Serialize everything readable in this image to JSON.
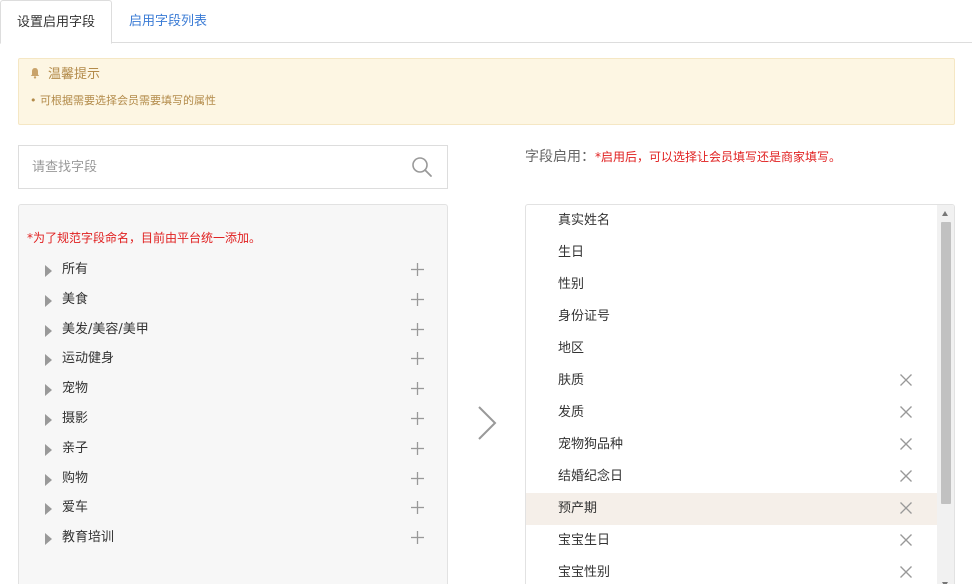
{
  "tabs": [
    {
      "label": "设置启用字段",
      "active": true
    },
    {
      "label": "启用字段列表",
      "active": false
    }
  ],
  "notice": {
    "icon": "bell-icon",
    "title": "温馨提示",
    "item": "• 可根据需要选择会员需要填写的属性"
  },
  "search": {
    "placeholder": "请查找字段",
    "value": "",
    "icon": "search-icon"
  },
  "left_panel": {
    "note": "*为了规范字段命名，目前由平台统一添加。",
    "categories": [
      {
        "label": "所有"
      },
      {
        "label": "美食"
      },
      {
        "label": "美发/美容/美甲"
      },
      {
        "label": "运动健身"
      },
      {
        "label": "宠物"
      },
      {
        "label": "摄影"
      },
      {
        "label": "亲子"
      },
      {
        "label": "购物"
      },
      {
        "label": "爱车"
      },
      {
        "label": "教育培训"
      }
    ]
  },
  "right_panel": {
    "heading": "字段启用：",
    "note": "*启用后，可以选择让会员填写还是商家填写。",
    "fields": [
      {
        "label": "真实姓名",
        "removable": false,
        "highlighted": false
      },
      {
        "label": "生日",
        "removable": false,
        "highlighted": false
      },
      {
        "label": "性别",
        "removable": false,
        "highlighted": false
      },
      {
        "label": "身份证号",
        "removable": false,
        "highlighted": false
      },
      {
        "label": "地区",
        "removable": false,
        "highlighted": false
      },
      {
        "label": "肤质",
        "removable": true,
        "highlighted": false
      },
      {
        "label": "发质",
        "removable": true,
        "highlighted": false
      },
      {
        "label": "宠物狗品种",
        "removable": true,
        "highlighted": false
      },
      {
        "label": "结婚纪念日",
        "removable": true,
        "highlighted": false
      },
      {
        "label": "预产期",
        "removable": true,
        "highlighted": true
      },
      {
        "label": "宝宝生日",
        "removable": true,
        "highlighted": false
      },
      {
        "label": "宝宝性别",
        "removable": true,
        "highlighted": false
      }
    ]
  },
  "colors": {
    "link": "#3a7bd5",
    "warning_text": "#b38b4a",
    "warning_bg": "#fdf6e3",
    "required_red": "#e02020",
    "highlight_row": "#f5efe9"
  }
}
